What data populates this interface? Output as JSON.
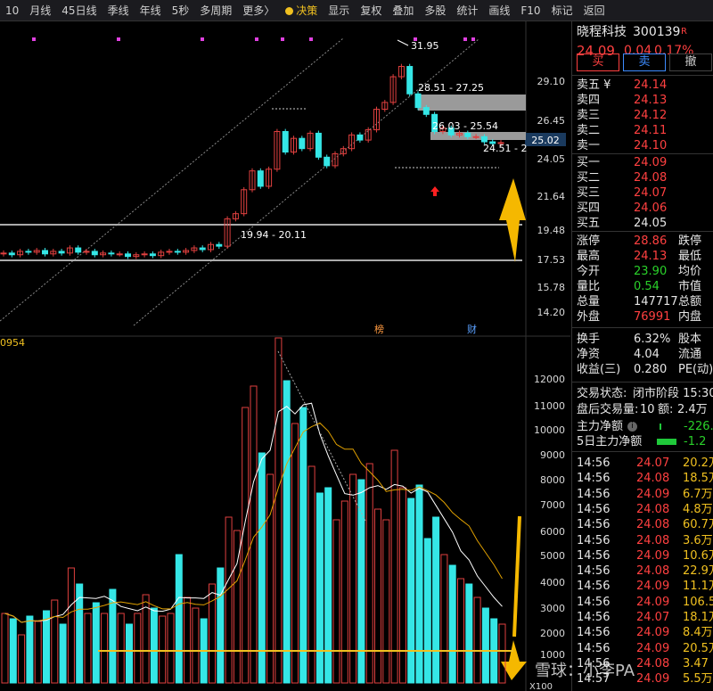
{
  "toolbar": {
    "items": [
      "10",
      "月线",
      "45日线",
      "季线",
      "年线",
      "5秒",
      "多周期",
      "更多〉",
      "决策",
      "显示",
      "复权",
      "叠加",
      "多股",
      "统计",
      "画线",
      "F10",
      "标记",
      "返回"
    ]
  },
  "chart": {
    "price_labels": [
      "29.10",
      "26.45",
      "24.05",
      "21.64",
      "19.48",
      "17.53",
      "15.78",
      "14.20"
    ],
    "current_price_tag": "25.02",
    "high_label": "31.95",
    "zone_labels": [
      "28.51 - 27.25",
      "26.03 - 25.54",
      "24.51 - 2",
      "19.94 - 20.11"
    ],
    "volume_axis": [
      "12000",
      "11000",
      "10000",
      "9000",
      "8000",
      "7000",
      "6000",
      "5000",
      "4000",
      "3000",
      "2000",
      "1000"
    ],
    "volume_top_label": "0954",
    "volume_multiplier": "X100",
    "event_marks": [
      "榜",
      "财"
    ],
    "colors": {
      "up": "#e0403f",
      "down": "#35e6e6",
      "ma_white": "#ffffff",
      "ma_yellow": "#e0a000",
      "arrow": "#f5b800"
    }
  },
  "chart_data": {
    "type": "bar",
    "title": "",
    "candles_range": {
      "low": 14.2,
      "high": 31.95
    },
    "volume_ylim": [
      0,
      12500
    ],
    "volume_values": [
      2600,
      2400,
      1800,
      2500,
      2300,
      2700,
      3100,
      2200,
      4300,
      3700,
      2600,
      3000,
      2600,
      3500,
      2600,
      2200,
      2600,
      3300,
      2800,
      2500,
      2600,
      4800,
      3200,
      2800,
      2400,
      3700,
      4300,
      6200,
      5700,
      10300,
      11100,
      8600,
      7800,
      12900,
      11300,
      9700,
      10300,
      8100,
      7100,
      7300,
      6100,
      6800,
      7800,
      7600,
      8200,
      6500,
      6100,
      8700,
      7300,
      6900,
      7400,
      5400,
      6200,
      4800,
      4400,
      3900,
      3700,
      3200,
      2800,
      2400,
      2200
    ]
  },
  "stock": {
    "name": "晓程科技",
    "code": "300139",
    "flag": "R",
    "price": "24.09",
    "change": "0.04",
    "pct": "0.17%"
  },
  "buttons": {
    "buy": "买",
    "sell": "卖",
    "cancel": "撤"
  },
  "asks": [
    {
      "label": "卖五 ¥",
      "price": "24.14"
    },
    {
      "label": "卖四",
      "price": "24.13"
    },
    {
      "label": "卖三",
      "price": "24.12"
    },
    {
      "label": "卖二",
      "price": "24.11"
    },
    {
      "label": "卖一",
      "price": "24.10"
    }
  ],
  "bids": [
    {
      "label": "买一",
      "price": "24.09"
    },
    {
      "label": "买二",
      "price": "24.08"
    },
    {
      "label": "买三",
      "price": "24.07"
    },
    {
      "label": "买四",
      "price": "24.06"
    },
    {
      "label": "买五",
      "price": "24.05"
    }
  ],
  "stats": [
    {
      "l1": "涨停",
      "v1": "28.86",
      "l2": "跌停"
    },
    {
      "l1": "最高",
      "v1": "24.13",
      "l2": "最低"
    },
    {
      "l1": "今开",
      "v1": "23.90",
      "l2": "均价"
    },
    {
      "l1": "量比",
      "v1": "0.54",
      "l2": "市值"
    },
    {
      "l1": "总量",
      "v1": "147717",
      "l2": "总额"
    },
    {
      "l1": "外盘",
      "v1": "76991",
      "l2": "内盘"
    }
  ],
  "stats2": [
    {
      "l1": "换手",
      "v1": "6.32%",
      "l2": "股本"
    },
    {
      "l1": "净资",
      "v1": "4.04",
      "l2": "流通"
    },
    {
      "l1": "收益(三)",
      "v1": "0.280",
      "l2": "PE(动)"
    }
  ],
  "trade_status": {
    "label": "交易状态:",
    "value": "闭市阶段 15:30"
  },
  "after_hours": {
    "label": "盘后交易量:",
    "value": "10",
    "amount_label": "额:",
    "amount": "2.4万"
  },
  "capital_flow": [
    {
      "label": "主力净额",
      "value": "-226."
    },
    {
      "label": "5日主力净额",
      "value": "-1.2"
    }
  ],
  "ticks": [
    {
      "time": "14:56",
      "price": "24.07",
      "vol": "20.2万"
    },
    {
      "time": "14:56",
      "price": "24.08",
      "vol": "18.5万"
    },
    {
      "time": "14:56",
      "price": "24.09",
      "vol": "6.7万"
    },
    {
      "time": "14:56",
      "price": "24.08",
      "vol": "4.8万"
    },
    {
      "time": "14:56",
      "price": "24.08",
      "vol": "60.7万"
    },
    {
      "time": "14:56",
      "price": "24.08",
      "vol": "3.6万"
    },
    {
      "time": "14:56",
      "price": "24.09",
      "vol": "10.6万"
    },
    {
      "time": "14:56",
      "price": "24.08",
      "vol": "22.9万"
    },
    {
      "time": "14:56",
      "price": "24.09",
      "vol": "11.1万"
    },
    {
      "time": "14:56",
      "price": "24.09",
      "vol": "106.5万"
    },
    {
      "time": "14:56",
      "price": "24.07",
      "vol": "18.1万"
    },
    {
      "time": "14:56",
      "price": "24.09",
      "vol": "8.4万"
    },
    {
      "time": "14:56",
      "price": "24.09",
      "vol": "20.5万"
    },
    {
      "time": "14:56",
      "price": "24.08",
      "vol": "3.47"
    },
    {
      "time": "14:57",
      "price": "24.09",
      "vol": "5.5万"
    }
  ],
  "watermark": "雪球：小李PA"
}
